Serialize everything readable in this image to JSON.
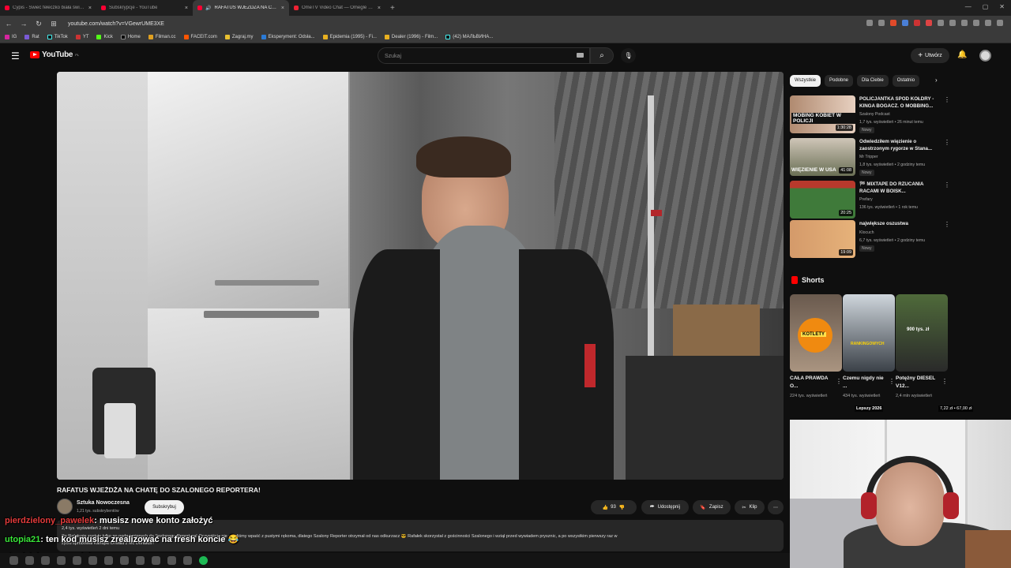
{
  "browser": {
    "tabs": [
      {
        "title": "Cypis - Świeć fełeczko biała świeć - Y",
        "active": false
      },
      {
        "title": "Subskrypcje - YouTube",
        "active": false
      },
      {
        "title": "RAFATUS WJEŻDŻA NA CHA",
        "active": true
      },
      {
        "title": "OmeTV Video Chat — Omegle Rand",
        "active": false
      }
    ],
    "url": "youtube.com/watch?v=VGewrUME3XE",
    "bookmarks": [
      "IG",
      "Rat",
      "TikTok",
      "YT",
      "Kick",
      "Home",
      "Filman.cc",
      "FACEIT.com",
      "Zagraj.my",
      "Eksperyment: Odsła...",
      "Epidemia (1995) - Fi...",
      "Dealer (1996) - Film...",
      "(42) МАЛЬВИНА..."
    ]
  },
  "youtube": {
    "logo_text": "YouTube",
    "region": "PL",
    "search_placeholder": "Szukaj",
    "create_label": "Utwórz"
  },
  "video": {
    "title": "RAFATUS WJEŻDŻA NA CHATĘ DO SZALONEGO REPORTERA!",
    "channel": "Sztuka Nowoczesna",
    "subscribers": "1,21 tys. subskrybentów",
    "subscribe_label": "Subskrybuj",
    "likes": "93",
    "share_label": "Udostępnij",
    "save_label": "Zapisz",
    "clip_label": "Klip",
    "views_meta": "2,4 tys. wyświetleń  2 dni temu",
    "description": "Po Rafatusie zostały tylko po podmienionych do Szalonego Reportera! Oczywiście nie mogliśmy wpaść z pustymi rękoma, dlatego Szalony Reporter otrzymał od nas odkurzacz 😎 Rafałek skorzystał z gościnności Szalonego i wziął przed wywiadem prysznic, a po wszystkim pierwszy raz w",
    "description_2": "życiu spróbował Kanapki Drwala z Mc Donalds!!"
  },
  "chat": [
    {
      "user": "pierdzielony_pawelek",
      "message": ": musisz nowe konto założyć",
      "color": "#e23b3b"
    },
    {
      "user": "utopia21",
      "message": ": ten kod musisz zrealizować na fresh koncie",
      "color": "#39e639"
    },
    {
      "user": "pierdzielony_pawelek",
      "message": "",
      "color": "#e23b3b"
    }
  ],
  "sidebar": {
    "chips": [
      "Wszystkie",
      "Podobne",
      "Dla Ciebie",
      "Ostatnio"
    ],
    "recommendations": [
      {
        "title": "POLICJANTKA SPOD KOŁDRY - KINGA BOGACZ. O MOBBING...",
        "channel": "Szalony Podcast",
        "views": "1,7 tys. wyświetleń • 26 minut temu",
        "badge": "Nowy",
        "duration": "1:30:28",
        "thumb_text": "MOBING KOBIET W POLICJI"
      },
      {
        "title": "Odwiedziłem więzienie o zaostrzonym rygorze w Stana...",
        "channel": "Mr Tripper",
        "views": "1,8 tys. wyświetleń • 2 godziny temu",
        "badge": "Nowy",
        "duration": "41:08",
        "thumb_text": "WIĘZIENIE W USA"
      },
      {
        "title": "🏁 MIXTAPE DO RZUCANIA RACAMI W BOISK...",
        "channel": "Prefary",
        "views": "136 tys. wyświetleń • 1 rok temu",
        "badge": "",
        "duration": "20:25",
        "thumb_text": ""
      },
      {
        "title": "największe oszustwa",
        "channel": "Klocuch",
        "views": "6,7 tys. wyświetleń • 2 godziny temu",
        "badge": "Nowy",
        "duration": "19:09",
        "thumb_text": ""
      }
    ],
    "shorts_label": "Shorts",
    "shorts": [
      {
        "title": "CAŁA PRAWDA O...",
        "views": "224 tys. wyświetleń",
        "thumb_text": "KOTLETY"
      },
      {
        "title": "Czemu nigdy nie ...",
        "views": "434 tys. wyświetleń",
        "thumb_text": "RANKINGOWYCH"
      },
      {
        "title": "Potężny DIESEL V12...",
        "views": "2,4 mln wyświetleń",
        "thumb_text": "900 tys. zł"
      }
    ],
    "promo_left": "Lepszy 2026",
    "promo_right": "7,22 zł • 67,00 zł"
  }
}
